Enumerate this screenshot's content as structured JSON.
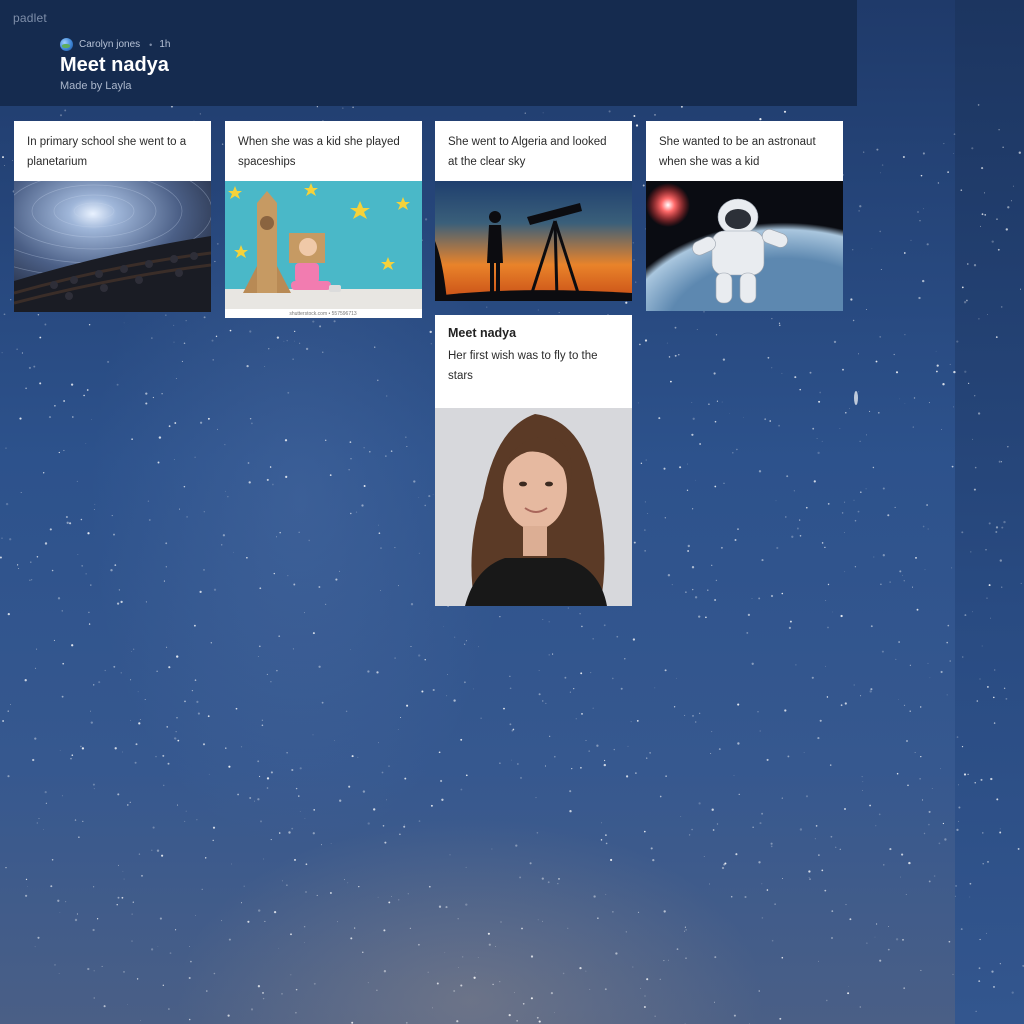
{
  "app": {
    "brand": "padlet"
  },
  "header": {
    "author": "Carolyn jones",
    "separator": "•",
    "time_ago": "1h",
    "title": "Meet nadya",
    "subtitle": "Made by Layla"
  },
  "posts": [
    {
      "text": "In primary school she went to a planetarium",
      "image": "planetarium-dome-photo"
    },
    {
      "text": "When she was a kid she played spaceships",
      "image": "girl-cardboard-rocket-photo",
      "image_caption": "shutterstock.com • 557596713"
    },
    {
      "text": "She went to Algeria and looked at the clear sky",
      "image": "telescope-silhouette-sunset-photo"
    },
    {
      "text": "She wanted to be an astronaut when she was a kid",
      "image": "astronaut-spacewalk-photo"
    },
    {
      "title": "Meet nadya",
      "text": "Her first wish was to fly to the stars",
      "image": "portrait-photo"
    }
  ],
  "colors": {
    "header_bg": "#152b4f",
    "card_bg": "#ffffff",
    "background": "#2d528c"
  }
}
